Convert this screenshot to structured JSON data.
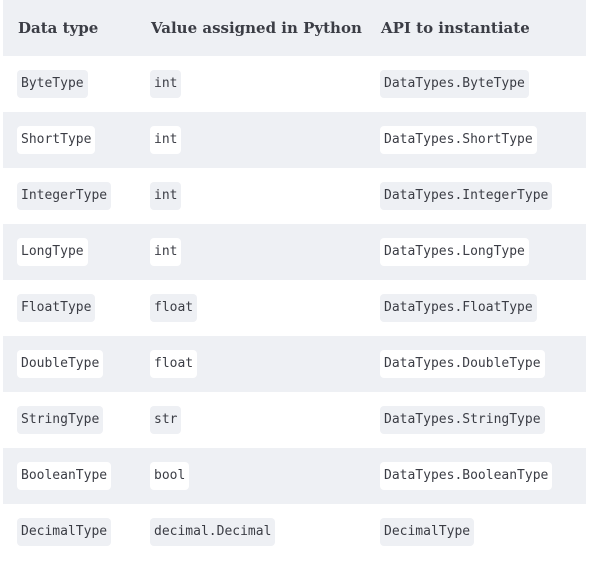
{
  "table": {
    "headers": [
      "Data type",
      "Value assigned in Python",
      "API to instantiate"
    ],
    "rows": [
      [
        "ByteType",
        "int",
        "DataTypes.ByteType"
      ],
      [
        "ShortType",
        "int",
        "DataTypes.ShortType"
      ],
      [
        "IntegerType",
        "int",
        "DataTypes.IntegerType"
      ],
      [
        "LongType",
        "int",
        "DataTypes.LongType"
      ],
      [
        "FloatType",
        "float",
        "DataTypes.FloatType"
      ],
      [
        "DoubleType",
        "float",
        "DataTypes.DoubleType"
      ],
      [
        "StringType",
        "str",
        "DataTypes.StringType"
      ],
      [
        "BooleanType",
        "bool",
        "DataTypes.BooleanType"
      ],
      [
        "DecimalType",
        "decimal.Decimal",
        "DecimalType"
      ]
    ]
  }
}
